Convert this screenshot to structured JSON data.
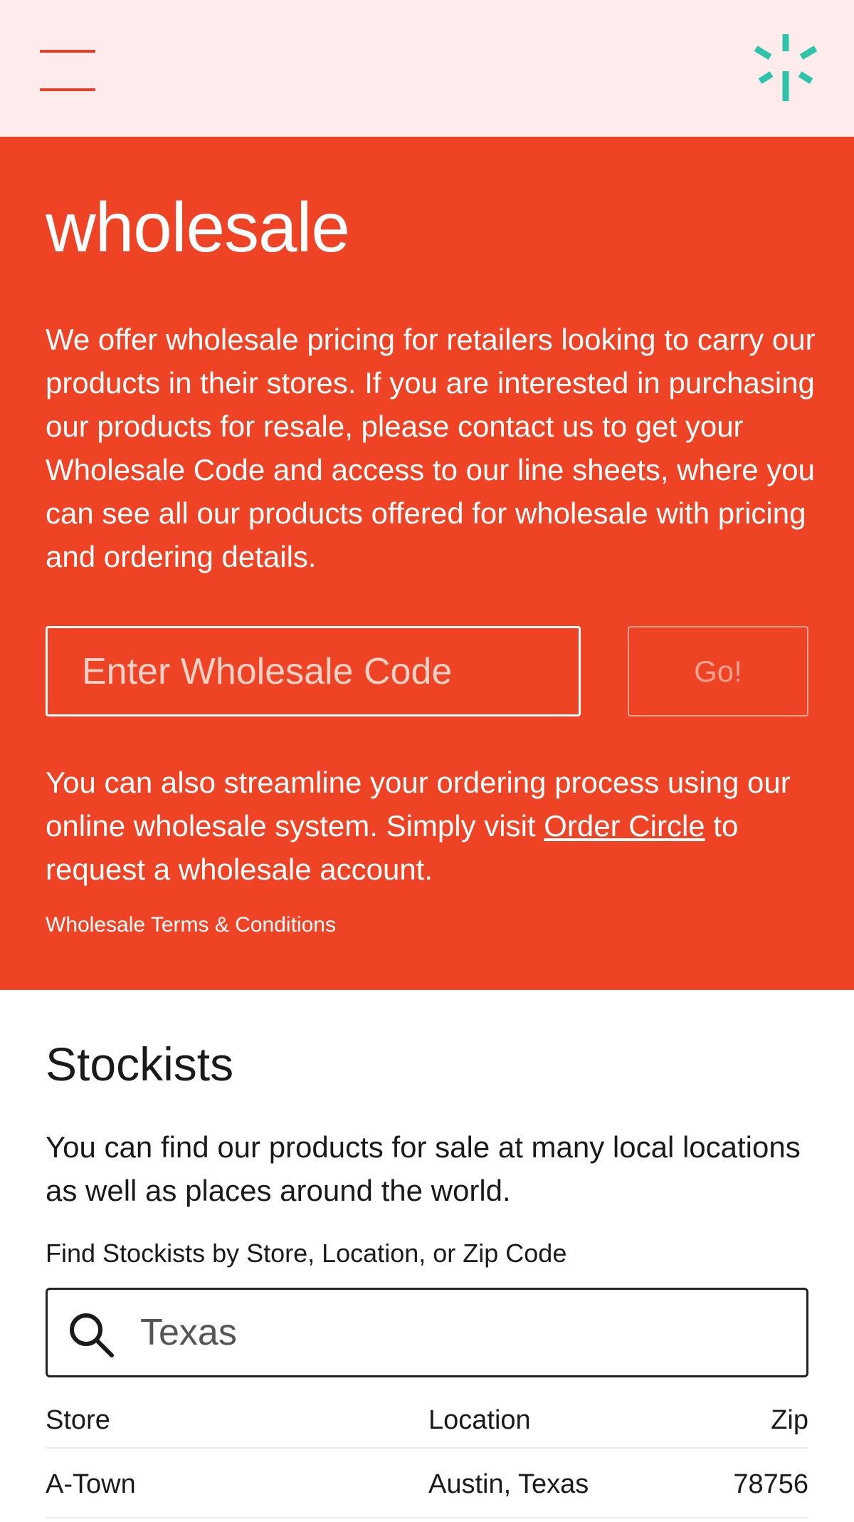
{
  "header": {
    "menu_icon": "hamburger-menu-icon",
    "brand_icon": "starburst-logo-icon",
    "colors": {
      "background": "#fdeceb",
      "accent": "#e8402a",
      "brand": "#2ec4a9"
    }
  },
  "wholesale": {
    "title": "wholesale",
    "description": "We offer wholesale pricing for retailers looking to carry our products in their stores. If you are interested in purchasing our products for resale, please contact us to get your Wholesale Code and access to our line sheets, where you can see all our products offered for wholesale with pricing and ordering details.",
    "code_placeholder": "Enter Wholesale Code",
    "code_value": "",
    "go_label": "Go!",
    "order_text_before": "You can also streamline your ordering process using our online wholesale system. Simply visit ",
    "order_link": "Order Circle",
    "order_text_after": " to request a wholesale account.",
    "terms_link": "Wholesale Terms & Conditions",
    "colors": {
      "background": "#ee4325",
      "text": "#ffffff"
    }
  },
  "stockists": {
    "title": "Stockists",
    "description": "You can find our products for sale at many local locations as well as places around the world.",
    "search_label": "Find Stockists by Store, Location, or Zip Code",
    "search_value": "Texas",
    "search_icon": "search-icon",
    "table": {
      "headers": {
        "store": "Store",
        "location": "Location",
        "zip": "Zip"
      },
      "rows": [
        {
          "store": "A-Town",
          "location": "Austin, Texas",
          "zip": "78756"
        }
      ]
    }
  }
}
